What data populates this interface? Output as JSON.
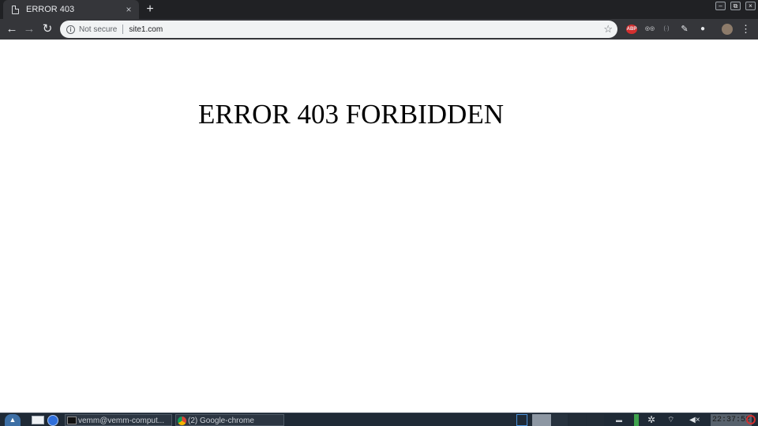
{
  "browser": {
    "tab": {
      "title": "ERROR 403",
      "close_glyph": "×"
    },
    "new_tab_glyph": "+",
    "window_controls": {
      "minimize": "–",
      "restore": "⧉",
      "close": "×"
    },
    "toolbar": {
      "back_glyph": "←",
      "forward_glyph": "→",
      "reload_glyph": "↻",
      "security_icon": "info-icon",
      "security_text": "Not secure",
      "url": "site1.com",
      "bookmark_glyph": "☆",
      "extensions": [
        {
          "name": "adblock-plus-icon",
          "label": "ABP"
        },
        {
          "name": "spy-glasses-icon",
          "label": "◎◎"
        },
        {
          "name": "broadcast-icon",
          "label": "(·)"
        },
        {
          "name": "pen-icon",
          "label": "✎"
        },
        {
          "name": "circle-icon",
          "label": "●"
        }
      ],
      "profile_icon": "avatar",
      "menu_glyph": "⋮"
    }
  },
  "page": {
    "heading": "ERROR 403 FORBIDDEN"
  },
  "taskbar": {
    "start_icon": "arch-start-icon",
    "tasks": [
      {
        "icon": "terminal-icon",
        "label": "vemm@vemm-comput..."
      },
      {
        "icon": "chrome-icon",
        "label": "(2) Google-chrome"
      }
    ],
    "clock": "22:37:52",
    "colors": {
      "panel": "#1f2a36",
      "power": "#d32f2f"
    }
  }
}
